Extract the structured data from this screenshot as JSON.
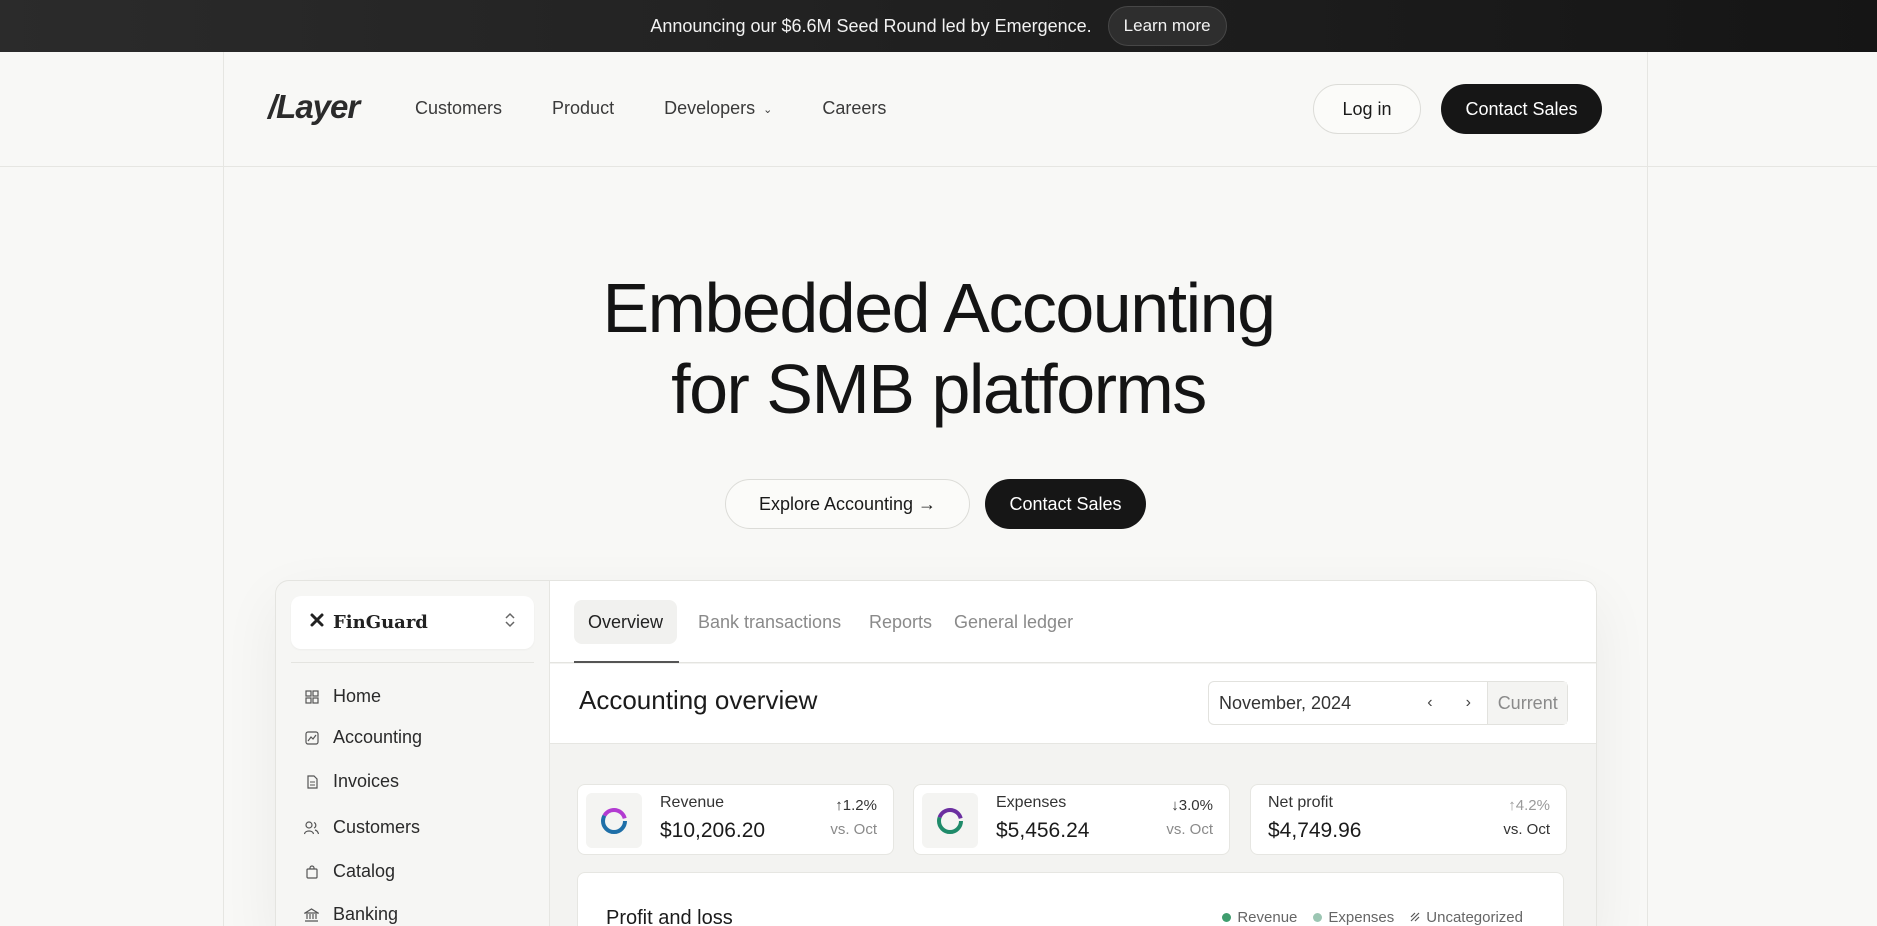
{
  "banner": {
    "text": "Announcing our $6.6M Seed Round led by Emergence.",
    "cta": "Learn more"
  },
  "header": {
    "logo": "/Layer",
    "nav": [
      {
        "label": "Customers"
      },
      {
        "label": "Product"
      },
      {
        "label": "Developers",
        "has_dropdown": true
      },
      {
        "label": "Careers"
      }
    ],
    "login": "Log in",
    "contact": "Contact Sales"
  },
  "hero": {
    "line1": "Embedded Accounting",
    "line2": "for SMB platforms",
    "cta_secondary": "Explore Accounting →",
    "cta_primary": "Contact Sales"
  },
  "app": {
    "org_name": "FinGuard",
    "sidebar": [
      {
        "label": "Home",
        "icon": "grid-icon"
      },
      {
        "label": "Accounting",
        "icon": "chart-icon"
      },
      {
        "label": "Invoices",
        "icon": "document-icon"
      },
      {
        "label": "Customers",
        "icon": "users-icon"
      },
      {
        "label": "Catalog",
        "icon": "bag-icon"
      },
      {
        "label": "Banking",
        "icon": "bank-icon"
      }
    ],
    "tabs": [
      {
        "label": "Overview",
        "active": true
      },
      {
        "label": "Bank transactions"
      },
      {
        "label": "Reports"
      },
      {
        "label": "General ledger"
      }
    ],
    "overview_title": "Accounting overview",
    "date": {
      "month": "November, 2024",
      "current": "Current"
    },
    "stats": [
      {
        "label": "Revenue",
        "value": "$10,206.20",
        "change": "↑1.2%",
        "vs": "vs. Oct"
      },
      {
        "label": "Expenses",
        "value": "$5,456.24",
        "change": "↓3.0%",
        "vs": "vs. Oct"
      },
      {
        "label": "Net profit",
        "value": "$4,749.96",
        "change": "↑4.2%",
        "vs": "vs. Oct"
      }
    ],
    "pnl": {
      "title": "Profit and loss",
      "legend": [
        {
          "label": "Revenue",
          "color": "#3f9d6e"
        },
        {
          "label": "Expenses",
          "color": "#9cc6b3"
        },
        {
          "label": "Uncategorized",
          "color": "#555555"
        }
      ]
    }
  },
  "colors": {
    "banner_bg": "#1f1f1f",
    "primary_button": "#161616",
    "accent_green": "#3f9d6e"
  }
}
